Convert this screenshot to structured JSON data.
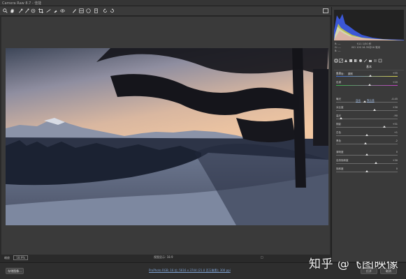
{
  "window": {
    "title": "Camera Raw 8.7 - 佳能"
  },
  "toolbar": {
    "tools": [
      "zoom-icon",
      "hand-icon",
      "white-balance-icon",
      "color-sampler-icon",
      "targeted-adjustment-icon",
      "crop-icon",
      "straighten-icon",
      "spot-removal-icon",
      "red-eye-icon",
      "adjustment-brush-icon",
      "graduated-filter-icon",
      "radial-filter-icon",
      "preferences-icon",
      "rotate-left-icon",
      "rotate-right-icon"
    ]
  },
  "panel": {
    "readouts": [
      {
        "c1": "R: ---",
        "c2": "f/11  1/50 秒",
        "c3": ""
      },
      {
        "c1": "G: ---",
        "c2": "ISO 100  16-35@16 毫米",
        "c3": ""
      },
      {
        "c1": "B: ---",
        "c2": "",
        "c3": ""
      }
    ],
    "section_title": "基本",
    "process_label": "白平衡:",
    "process_value": "原照",
    "auto_label": "自动",
    "default_label": "默认值",
    "sliders": [
      {
        "label": "色温",
        "value": "+55",
        "pos": 0.56,
        "kind": "wb"
      },
      {
        "label": "色调",
        "value": "+20",
        "pos": 0.54,
        "kind": "tint"
      },
      {
        "label": "曝光",
        "value": "-0.45",
        "pos": 0.47,
        "kind": ""
      },
      {
        "label": "对比度",
        "value": "+30",
        "pos": 0.62,
        "kind": ""
      },
      {
        "label": "高光",
        "value": "-90",
        "pos": 0.08,
        "kind": ""
      },
      {
        "label": "阴影",
        "value": "+51",
        "pos": 0.78,
        "kind": ""
      },
      {
        "label": "白色",
        "value": "+1",
        "pos": 0.5,
        "kind": ""
      },
      {
        "label": "黑色",
        "value": "-2",
        "pos": 0.48,
        "kind": ""
      },
      {
        "label": "清晰度",
        "value": "0",
        "pos": 0.5,
        "kind": ""
      },
      {
        "label": "自然饱和度",
        "value": "+30",
        "pos": 0.65,
        "kind": ""
      },
      {
        "label": "饱和度",
        "value": "0",
        "pos": 0.5,
        "kind": ""
      }
    ]
  },
  "status": {
    "zoom_label": "缩放",
    "zoom_value": "18.9%",
    "center_text": "视图显示: 18.9",
    "right_text": "□"
  },
  "bottom": {
    "save_image": "存储图像...",
    "workflow_link": "ProPhoto RGB; 16 位; 5616 x 3744 (21.0 百万像素); 300 ppi",
    "open_image": "打开",
    "cancel": "取消"
  },
  "watermark": "知乎 @飞图映像"
}
